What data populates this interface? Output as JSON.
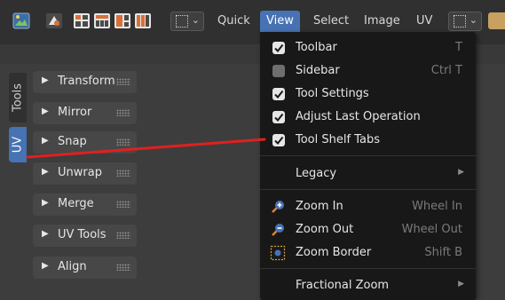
{
  "header": {
    "icons": [
      "image-editor-icon",
      "tool-icon",
      "view-grid-icon-1",
      "view-grid-icon-2",
      "view-grid-icon-3",
      "view-grid-icon-4"
    ],
    "menus": [
      "Quick",
      "View",
      "Select",
      "Image",
      "UV"
    ],
    "active_menu": "View"
  },
  "side_tabs": [
    "Tools",
    "UV"
  ],
  "active_side_tab": "UV",
  "panels": [
    "Transform",
    "Mirror",
    "Snap",
    "Unwrap",
    "Merge",
    "UV Tools",
    "Align"
  ],
  "view_menu": {
    "toolbar": {
      "label": "Toolbar",
      "shortcut": "T",
      "checked": true
    },
    "sidebar": {
      "label": "Sidebar",
      "shortcut": "Ctrl T",
      "checked": false
    },
    "tool_settings": {
      "label": "Tool Settings",
      "checked": true
    },
    "adjust_last": {
      "label": "Adjust Last Operation",
      "checked": true
    },
    "tool_shelf_tabs": {
      "label": "Tool Shelf Tabs",
      "checked": true
    },
    "legacy": {
      "label": "Legacy"
    },
    "zoom_in": {
      "label": "Zoom In",
      "shortcut": "Wheel In"
    },
    "zoom_out": {
      "label": "Zoom Out",
      "shortcut": "Wheel Out"
    },
    "zoom_border": {
      "label": "Zoom Border",
      "shortcut": "Shift B"
    },
    "fractional_zoom": {
      "label": "Fractional Zoom"
    }
  },
  "colors": {
    "accent": "#4772b3",
    "annotation_line": "#e02020"
  }
}
